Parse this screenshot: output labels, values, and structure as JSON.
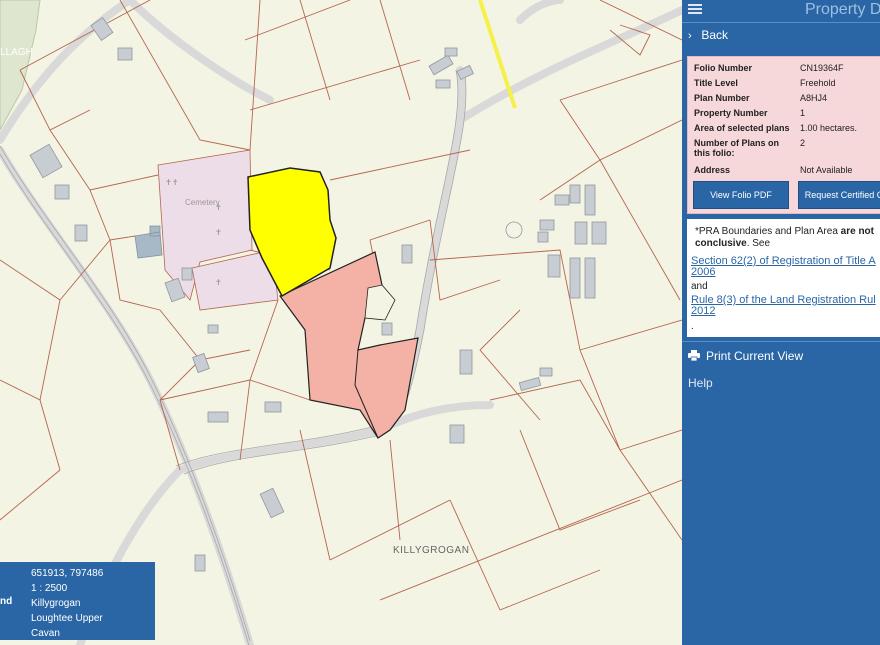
{
  "map": {
    "townland_label_top": "LLAGH",
    "cemetery_label": "Cemetery",
    "townland_label": "KILLYGROGAN"
  },
  "infobox": {
    "label": "nd",
    "coordinates": "651913, 797486",
    "scale": "1 : 2500",
    "townland": "Killygrogan",
    "barony": "Loughtee Upper",
    "county": "Cavan"
  },
  "panel": {
    "title": "Property D",
    "back_label": "Back",
    "details": [
      {
        "key": "Folio Number",
        "value": "CN19364F"
      },
      {
        "key": "Title Level",
        "value": "Freehold"
      },
      {
        "key": "Plan Number",
        "value": "A8HJ4"
      },
      {
        "key": "Property Number",
        "value": "1"
      },
      {
        "key": "Area of selected plans",
        "value": "1.00 hectares."
      },
      {
        "key": "Number of Plans on this folio:",
        "value": "2"
      },
      {
        "key": "Address",
        "value": "Not Available"
      }
    ],
    "view_folio_button": "View Folio PDF",
    "request_button": "Request Certified C",
    "notice_prefix": "*PRA Boundaries and Plan Area ",
    "notice_bold": "are not conclusive",
    "notice_suffix": ". See",
    "link1": "Section 62(2) of Registration of Title A",
    "link1_line2": "2006",
    "and": "and",
    "link2": "Rule 8(3) of the Land Registration Rul",
    "link2_line2": "2012",
    "notice_end": ".",
    "print_label": "Print Current View",
    "help_label": "Help"
  },
  "colors": {
    "panel_blue": "#2a66a6",
    "selected_plan": "#ffff00",
    "other_plan": "#f4b1a6",
    "cemetery": "#eddde8",
    "boundary": "#b4654e",
    "road": "#d9d9d9",
    "map_bg": "#f4f4e4"
  }
}
